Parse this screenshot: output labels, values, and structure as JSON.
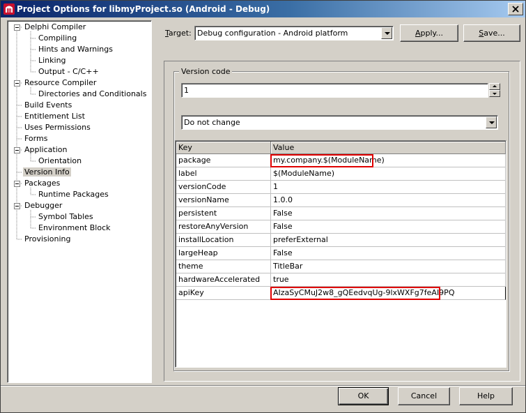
{
  "window": {
    "title": "Project Options for libmyProject.so  (Android - Debug)"
  },
  "tree": {
    "items": [
      {
        "label": "Delphi Compiler",
        "level": 0,
        "expander": "minus"
      },
      {
        "label": "Compiling",
        "level": 1
      },
      {
        "label": "Hints and Warnings",
        "level": 1
      },
      {
        "label": "Linking",
        "level": 1
      },
      {
        "label": "Output - C/C++",
        "level": 1
      },
      {
        "label": "Resource Compiler",
        "level": 0,
        "expander": "minus"
      },
      {
        "label": "Directories and Conditionals",
        "level": 1
      },
      {
        "label": "Build Events",
        "level": 0
      },
      {
        "label": "Entitlement List",
        "level": 0
      },
      {
        "label": "Uses Permissions",
        "level": 0
      },
      {
        "label": "Forms",
        "level": 0
      },
      {
        "label": "Application",
        "level": 0,
        "expander": "minus"
      },
      {
        "label": "Orientation",
        "level": 1
      },
      {
        "label": "Version Info",
        "level": 0,
        "selected": true
      },
      {
        "label": "Packages",
        "level": 0,
        "expander": "minus"
      },
      {
        "label": "Runtime Packages",
        "level": 1
      },
      {
        "label": "Debugger",
        "level": 0,
        "expander": "minus"
      },
      {
        "label": "Symbol Tables",
        "level": 1
      },
      {
        "label": "Environment Block",
        "level": 1
      },
      {
        "label": "Provisioning",
        "level": 0
      }
    ]
  },
  "toolbar": {
    "target_label_pre": "",
    "target_label_accel": "T",
    "target_label_post": "arget:",
    "target_value": "Debug configuration - Android platform",
    "apply_accel": "A",
    "apply_rest": "pply...",
    "save_accel": "S",
    "save_rest": "ave..."
  },
  "version": {
    "group_title": "Version code",
    "code_value": "1",
    "mode_value": "Do not change"
  },
  "grid": {
    "headers": [
      "Key",
      "Value"
    ],
    "rows": [
      {
        "key": "package",
        "value": "my.company.$(ModuleName)",
        "highlighted": true
      },
      {
        "key": "label",
        "value": "$(ModuleName)"
      },
      {
        "key": "versionCode",
        "value": "1"
      },
      {
        "key": "versionName",
        "value": "1.0.0"
      },
      {
        "key": "persistent",
        "value": "False"
      },
      {
        "key": "restoreAnyVersion",
        "value": "False"
      },
      {
        "key": "installLocation",
        "value": "preferExternal"
      },
      {
        "key": "largeHeap",
        "value": "False"
      },
      {
        "key": "theme",
        "value": "TitleBar"
      },
      {
        "key": "hardwareAccelerated",
        "value": "true"
      },
      {
        "key": "apiKey",
        "value": "AIzaSyCMuJ2w8_gQEedvqUg-9lxWXFg7feAI9PQ",
        "highlighted": true,
        "editing": true
      }
    ]
  },
  "dialog": {
    "ok_label": "OK",
    "cancel_label": "Cancel",
    "help_label": "Help"
  },
  "colors": {
    "highlight_border": "#e00000",
    "title_gradient_start": "#0a246a",
    "title_gradient_end": "#a6caf0",
    "face": "#d4d0c8"
  }
}
